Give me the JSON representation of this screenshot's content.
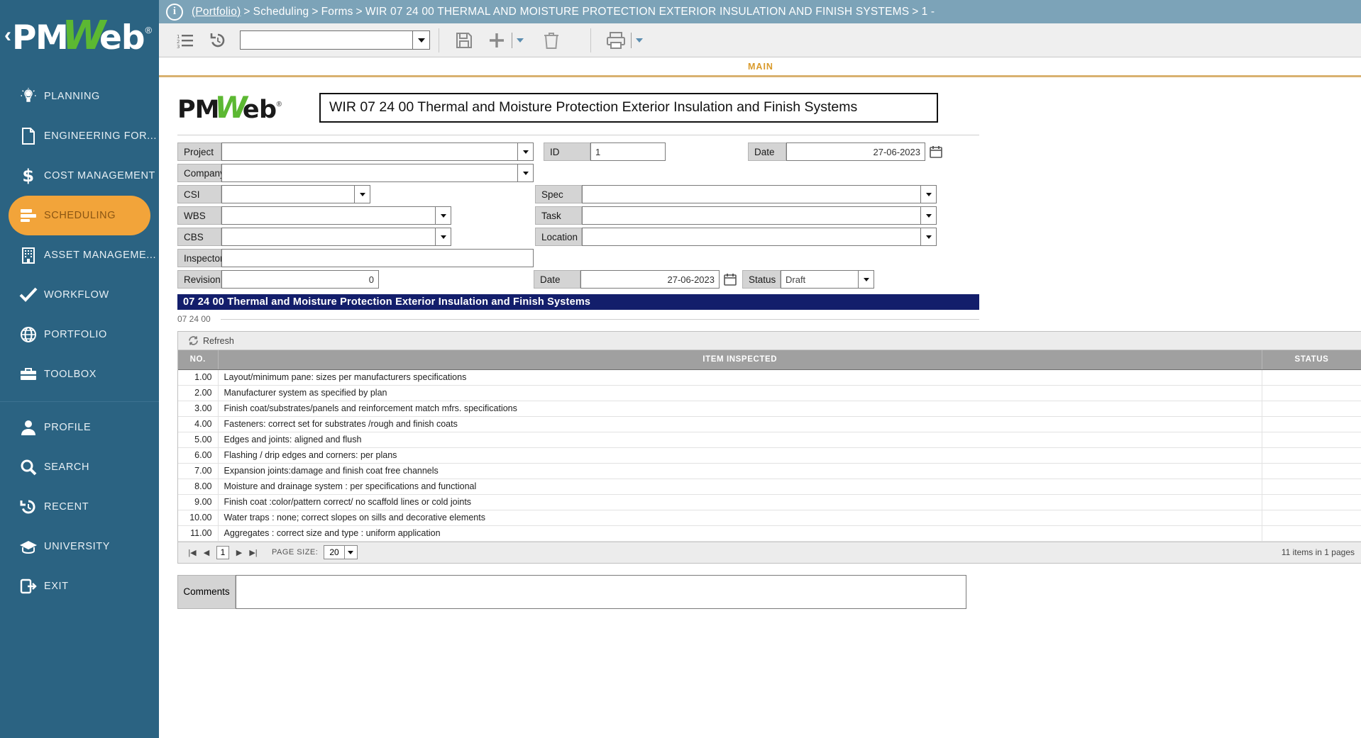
{
  "sidebar": {
    "brand": {
      "chevron": "‹",
      "pm": "PM",
      "w": "W",
      "eb": "eb",
      "reg": "®"
    },
    "items": [
      {
        "label": "PLANNING",
        "icon": "lightbulb-icon",
        "active": false
      },
      {
        "label": "ENGINEERING FOR...",
        "icon": "document-icon",
        "active": false
      },
      {
        "label": "COST MANAGEMENT",
        "icon": "dollar-icon",
        "active": false
      },
      {
        "label": "SCHEDULING",
        "icon": "bars-icon",
        "active": true
      },
      {
        "label": "ASSET MANAGEME...",
        "icon": "building-icon",
        "active": false
      },
      {
        "label": "WORKFLOW",
        "icon": "check-icon",
        "active": false
      },
      {
        "label": "PORTFOLIO",
        "icon": "globe-icon",
        "active": false
      },
      {
        "label": "TOOLBOX",
        "icon": "briefcase-icon",
        "active": false
      },
      {
        "label": "PROFILE",
        "icon": "user-icon",
        "active": false
      },
      {
        "label": "SEARCH",
        "icon": "search-icon",
        "active": false
      },
      {
        "label": "RECENT",
        "icon": "history-icon",
        "active": false
      },
      {
        "label": "UNIVERSITY",
        "icon": "graduation-cap-icon",
        "active": false
      },
      {
        "label": "EXIT",
        "icon": "exit-icon",
        "active": false
      }
    ]
  },
  "topbar": {
    "info_icon": "i",
    "breadcrumb": {
      "root": "(Portfolio)",
      "parts": [
        "Scheduling",
        "Forms",
        "WIR 07 24 00 THERMAL AND MOISTURE PROTECTION EXTERIOR INSULATION AND FINISH SYSTEMS",
        "1 -"
      ],
      "separator": ">"
    }
  },
  "toolbar": {
    "list_icon": "numbered-list-icon",
    "history_icon": "history-revert-icon",
    "select_value": "",
    "save_icon": "save-floppy-icon",
    "add_icon": "plus-icon",
    "delete_icon": "trash-icon",
    "print_icon": "printer-icon"
  },
  "tabs": {
    "main": "MAIN"
  },
  "form": {
    "logo": {
      "pm": "PM",
      "w": "W",
      "eb": "eb",
      "reg": "®"
    },
    "title": "WIR 07 24 00 Thermal and Moisture Protection Exterior Insulation and Finish Systems",
    "labels": {
      "project": "Project",
      "company": "Company",
      "csi": "CSI",
      "wbs": "WBS",
      "cbs": "CBS",
      "inspector": "Inspector",
      "revision": "Revision",
      "id": "ID",
      "spec": "Spec",
      "task": "Task",
      "location": "Location",
      "date": "Date",
      "date2": "Date",
      "status": "Status"
    },
    "values": {
      "project": "",
      "company": "",
      "csi": "",
      "wbs": "",
      "cbs": "",
      "inspector": "",
      "revision": "0",
      "id": "1",
      "spec": "",
      "task": "",
      "location": "",
      "date": "27-06-2023",
      "date2": "27-06-2023",
      "status": "Draft"
    }
  },
  "section": {
    "bar_title": "07 24 00 Thermal and Moisture Protection Exterior Insulation and Finish Systems",
    "sub_code": "07 24 00"
  },
  "grid": {
    "refresh_label": "Refresh",
    "columns": [
      "NO.",
      "ITEM INSPECTED",
      "STATUS"
    ],
    "rows": [
      {
        "no": "1.00",
        "item": "Layout/minimum pane: sizes per manufacturers specifications",
        "status": ""
      },
      {
        "no": "2.00",
        "item": "Manufacturer system as specified by plan",
        "status": ""
      },
      {
        "no": "3.00",
        "item": "Finish coat/substrates/panels and reinforcement match mfrs. specifications",
        "status": ""
      },
      {
        "no": "4.00",
        "item": "Fasteners: correct set for substrates /rough and finish coats",
        "status": ""
      },
      {
        "no": "5.00",
        "item": "Edges and joints: aligned and flush",
        "status": ""
      },
      {
        "no": "6.00",
        "item": "Flashing / drip edges and corners: per plans",
        "status": ""
      },
      {
        "no": "7.00",
        "item": "Expansion joints:damage and finish coat free channels",
        "status": ""
      },
      {
        "no": "8.00",
        "item": "Moisture and drainage system : per specifications and functional",
        "status": ""
      },
      {
        "no": "9.00",
        "item": "Finish coat :color/pattern correct/ no scaffold lines or cold joints",
        "status": ""
      },
      {
        "no": "10.00",
        "item": "Water traps : none; correct slopes on sills and decorative elements",
        "status": ""
      },
      {
        "no": "11.00",
        "item": "Aggregates : correct size and type : uniform application",
        "status": ""
      }
    ],
    "pager": {
      "first": "|◀",
      "prev": "◀",
      "page": "1",
      "next": "▶",
      "last": "▶|",
      "page_size_label": "PAGE SIZE:",
      "page_size": "20",
      "items_text": "11 items in 1 pages"
    }
  },
  "comments": {
    "label": "Comments",
    "value": "",
    "placeholder": ""
  },
  "colors": {
    "sidebar_bg": "#2b6382",
    "accent_orange": "#f2a43a",
    "topbar_bg": "#7ca3b8",
    "section_navy": "#131e6b",
    "brand_green": "#5cb832",
    "tab_gold": "#d99a2b"
  }
}
